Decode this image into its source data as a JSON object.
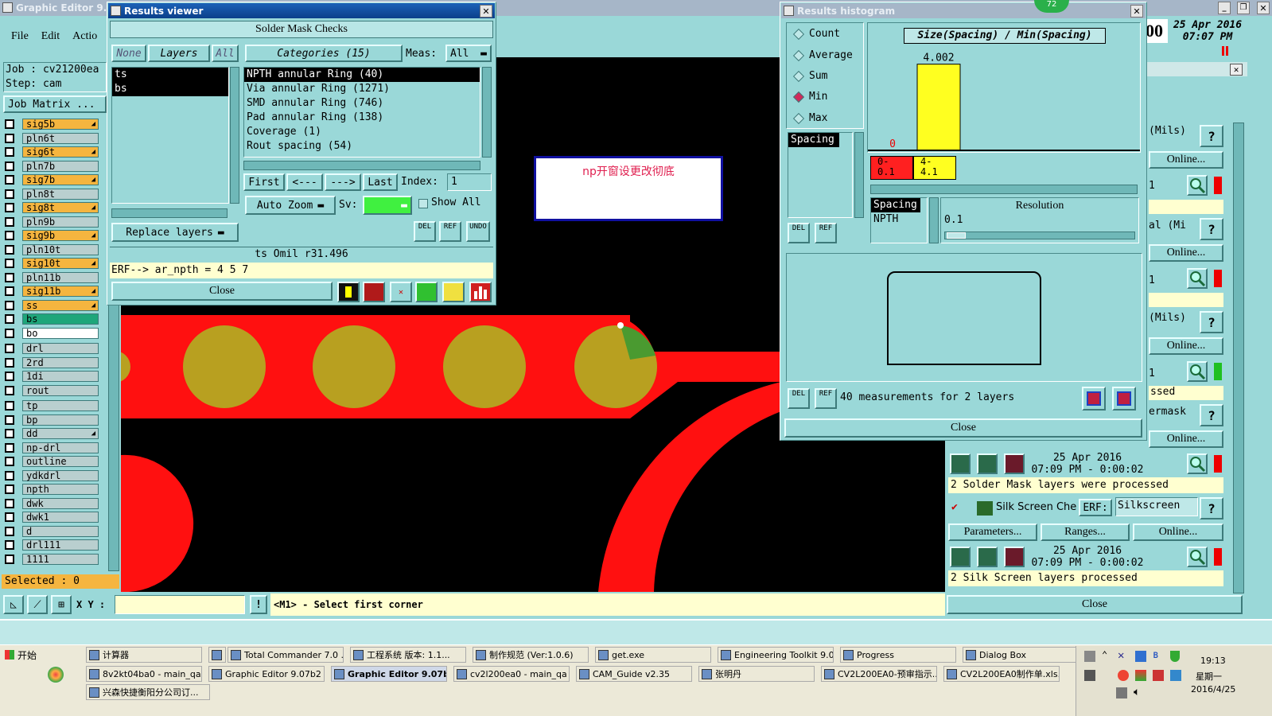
{
  "main": {
    "title": "Graphic Editor 9.07b",
    "menu": [
      "File",
      "Edit",
      "Actio"
    ],
    "job": "Job : cv21200ea",
    "step": "Step: cam",
    "job_matrix": "Job Matrix ...",
    "date": "25 Apr 2016",
    "time": "07:07 PM",
    "selected": "Selected : 0",
    "xy_label": "X Y :",
    "xy_value": "",
    "prompt": "<M1> - Select first corner"
  },
  "layers": [
    {
      "name": "sig5b",
      "color": "orange",
      "mark": true
    },
    {
      "name": "pln6t",
      "color": "gray"
    },
    {
      "name": "sig6t",
      "color": "orange",
      "mark": true
    },
    {
      "name": "pln7b",
      "color": "gray"
    },
    {
      "name": "sig7b",
      "color": "orange",
      "mark": true
    },
    {
      "name": "pln8t",
      "color": "gray"
    },
    {
      "name": "sig8t",
      "color": "orange",
      "mark": true
    },
    {
      "name": "pln9b",
      "color": "gray"
    },
    {
      "name": "sig9b",
      "color": "orange",
      "mark": true
    },
    {
      "name": "pln10t",
      "color": "gray"
    },
    {
      "name": "sig10t",
      "color": "orange",
      "mark": true
    },
    {
      "name": "pln11b",
      "color": "gray"
    },
    {
      "name": "sig11b",
      "color": "orange",
      "mark": true
    },
    {
      "name": "ss",
      "color": "orange",
      "mark": true
    },
    {
      "name": "bs",
      "color": "green"
    },
    {
      "name": "bo",
      "color": "white"
    },
    {
      "name": "drl",
      "color": "gray"
    },
    {
      "name": "2rd",
      "color": "gray"
    },
    {
      "name": "1di",
      "color": "gray"
    },
    {
      "name": "rout",
      "color": "gray"
    },
    {
      "name": "tp",
      "color": "gray"
    },
    {
      "name": "bp",
      "color": "gray"
    },
    {
      "name": "dd",
      "color": "gray",
      "mark": true
    },
    {
      "name": "np-drl",
      "color": "gray"
    },
    {
      "name": "outline",
      "color": "gray"
    },
    {
      "name": "ydkdrl",
      "color": "gray"
    },
    {
      "name": "npth",
      "color": "gray"
    },
    {
      "name": "dwk",
      "color": "gray"
    },
    {
      "name": "dwk1",
      "color": "gray"
    },
    {
      "name": "d",
      "color": "gray"
    },
    {
      "name": "drl111",
      "color": "gray"
    },
    {
      "name": "1111",
      "color": "gray"
    }
  ],
  "results_viewer": {
    "title": "Results viewer",
    "header": "Solder Mask Checks",
    "none": "None",
    "layers": "Layers",
    "all": "All",
    "categories": "Categories (15)",
    "meas_label": "Meas:",
    "meas_value": "All",
    "layer_list": [
      "ts",
      "bs"
    ],
    "cat_list": [
      "NPTH annular Ring (40)",
      "Via annular Ring (1271)",
      "SMD annular Ring (746)",
      "Pad annular Ring (138)",
      "Coverage (1)",
      "Rout spacing (54)"
    ],
    "first": "First",
    "prev": "<---",
    "next": "--->",
    "last": "Last",
    "index_label": "Index:",
    "index_value": "1",
    "auto_zoom": "Auto Zoom",
    "sv_label": "Sv:",
    "show_all": "Show All",
    "replace_layers": "Replace layers",
    "status": "ts  Omil   r31.496",
    "erf": "ERF--> ar_npth = 4 5 7",
    "close": "Close",
    "del": "DEL",
    "ref": "REF",
    "undo": "UNDO"
  },
  "note": "np开窗设更改彻底",
  "histogram": {
    "title": "Results histogram",
    "badge": "72",
    "modes": [
      "Count",
      "Average",
      "Sum",
      "Min",
      "Max"
    ],
    "active_mode": "Min",
    "spacing_list": [
      "Spacing"
    ],
    "chart_title": "Size(Spacing) / Min(Spacing)",
    "bar_label": "4.002",
    "zero_label": "0",
    "bins": [
      {
        "label": "0-\n0.1",
        "color": "#ff2020"
      },
      {
        "label": "4-\n4.1",
        "color": "#ffff20"
      }
    ],
    "sel_list": [
      "Spacing",
      "NPTH"
    ],
    "resolution_label": "Resolution",
    "resolution_value": "0.1",
    "measurements": "40 measurements for 2 layers",
    "close": "Close",
    "del": "DEL",
    "ref": "REF"
  },
  "chart_data": {
    "type": "bar",
    "title": "Size(Spacing) / Min(Spacing)",
    "categories": [
      "0-0.1",
      "4-4.1"
    ],
    "values": [
      0,
      4.002
    ]
  },
  "right_panel": {
    "mils1": "(Mils)",
    "online": "Online...",
    "one": "1",
    "mi": "al (Mi",
    "mils2": "(Mils)",
    "ssed": "ssed",
    "ermask": "ermask",
    "q": "?",
    "ts1_date": "25 Apr 2016",
    "ts1_time": "07:09 PM - 0:00:02",
    "sm_status": "2 Solder Mask layers were processed",
    "silk_label": "Silk Screen Che",
    "erf_label": "ERF:",
    "silk_erf": "Silkscreen",
    "parameters": "Parameters...",
    "ranges": "Ranges...",
    "online2": "Online...",
    "ts2_date": "25 Apr 2016",
    "ts2_time": "07:09 PM - 0:00:02",
    "ss_status": "2 Silk Screen layers processed",
    "close": "Close"
  },
  "taskbar": {
    "start": "开始",
    "row1": [
      "计算器",
      "",
      "Total Commander 7.0 ...",
      "工程系统  版本: 1.1...",
      "制作规范 (Ver:1.0.6)",
      "get.exe",
      "Engineering Toolkit 9.0...",
      "Progress",
      "Dialog Box"
    ],
    "row2": [
      "8v2kt04ba0 - main_qa",
      "Graphic Editor 9.07b2 (...",
      "Graphic Editor 9.07b...",
      "cv2l200ea0 - main_qa",
      "CAM_Guide v2.35",
      "张明丹",
      "CV2L200EA0-预审指示...",
      "CV2L200EA0制作单.xls..."
    ],
    "row3": [
      "兴森快捷衡阳分公司订..."
    ],
    "clock": "19:13",
    "weekday": "星期一",
    "date": "2016/4/25"
  },
  "colors": {
    "teal": "#9ad8d8",
    "red": "#ff1010",
    "pad": "#b8a020",
    "highlight": "#ffffd0"
  }
}
